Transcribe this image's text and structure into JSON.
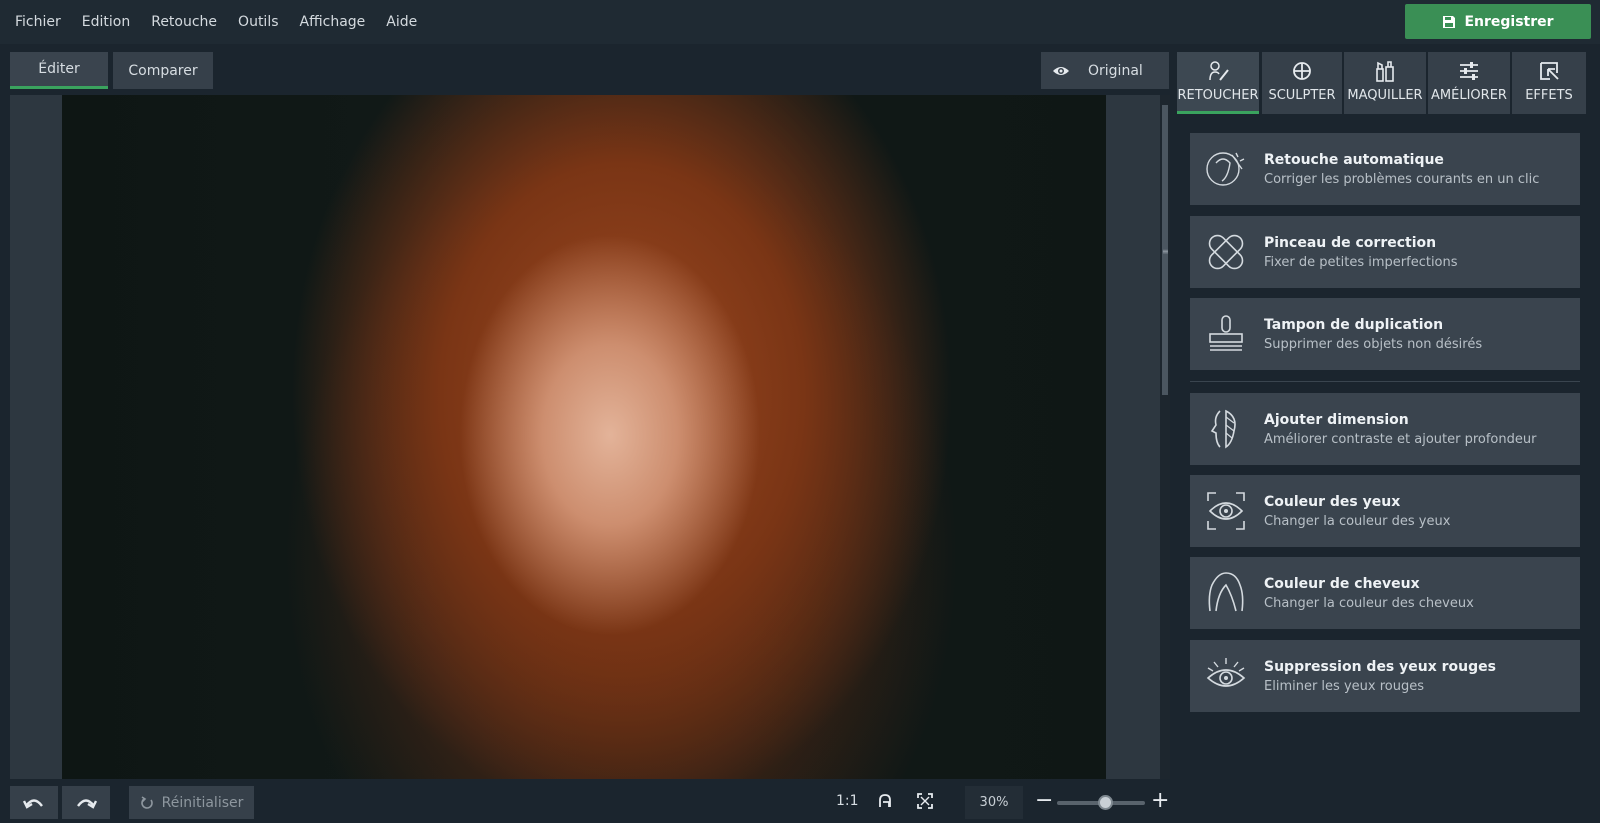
{
  "menu": [
    "Fichier",
    "Edition",
    "Retouche",
    "Outils",
    "Affichage",
    "Aide"
  ],
  "save_label": "Enregistrer",
  "view_tabs": {
    "edit": "Éditer",
    "compare": "Comparer"
  },
  "original_label": "Original",
  "bottom": {
    "reset_label": "Réinitialiser",
    "ratio_label": "1:1",
    "zoom_value": "30%",
    "zoom_level": 0.55
  },
  "right_tabs": [
    "RETOUCHER",
    "SCULPTER",
    "MAQUILLER",
    "AMÉLIORER",
    "EFFETS"
  ],
  "tools": [
    {
      "title": "Retouche automatique",
      "subtitle": "Corriger les problèmes courants en un clic"
    },
    {
      "title": "Pinceau de correction",
      "subtitle": "Fixer de petites imperfections"
    },
    {
      "title": "Tampon de duplication",
      "subtitle": "Supprimer des objets non désirés"
    },
    {
      "title": "Ajouter dimension",
      "subtitle": "Améliorer contraste et ajouter profondeur"
    },
    {
      "title": "Couleur des yeux",
      "subtitle": "Changer la couleur des yeux"
    },
    {
      "title": "Couleur de cheveux",
      "subtitle": "Changer la couleur des cheveux"
    },
    {
      "title": "Suppression des yeux rouges",
      "subtitle": "Eliminer les yeux rouges"
    }
  ],
  "colors": {
    "accent": "#3aa35e",
    "save": "#3a8f55",
    "background": "#1b252e"
  }
}
